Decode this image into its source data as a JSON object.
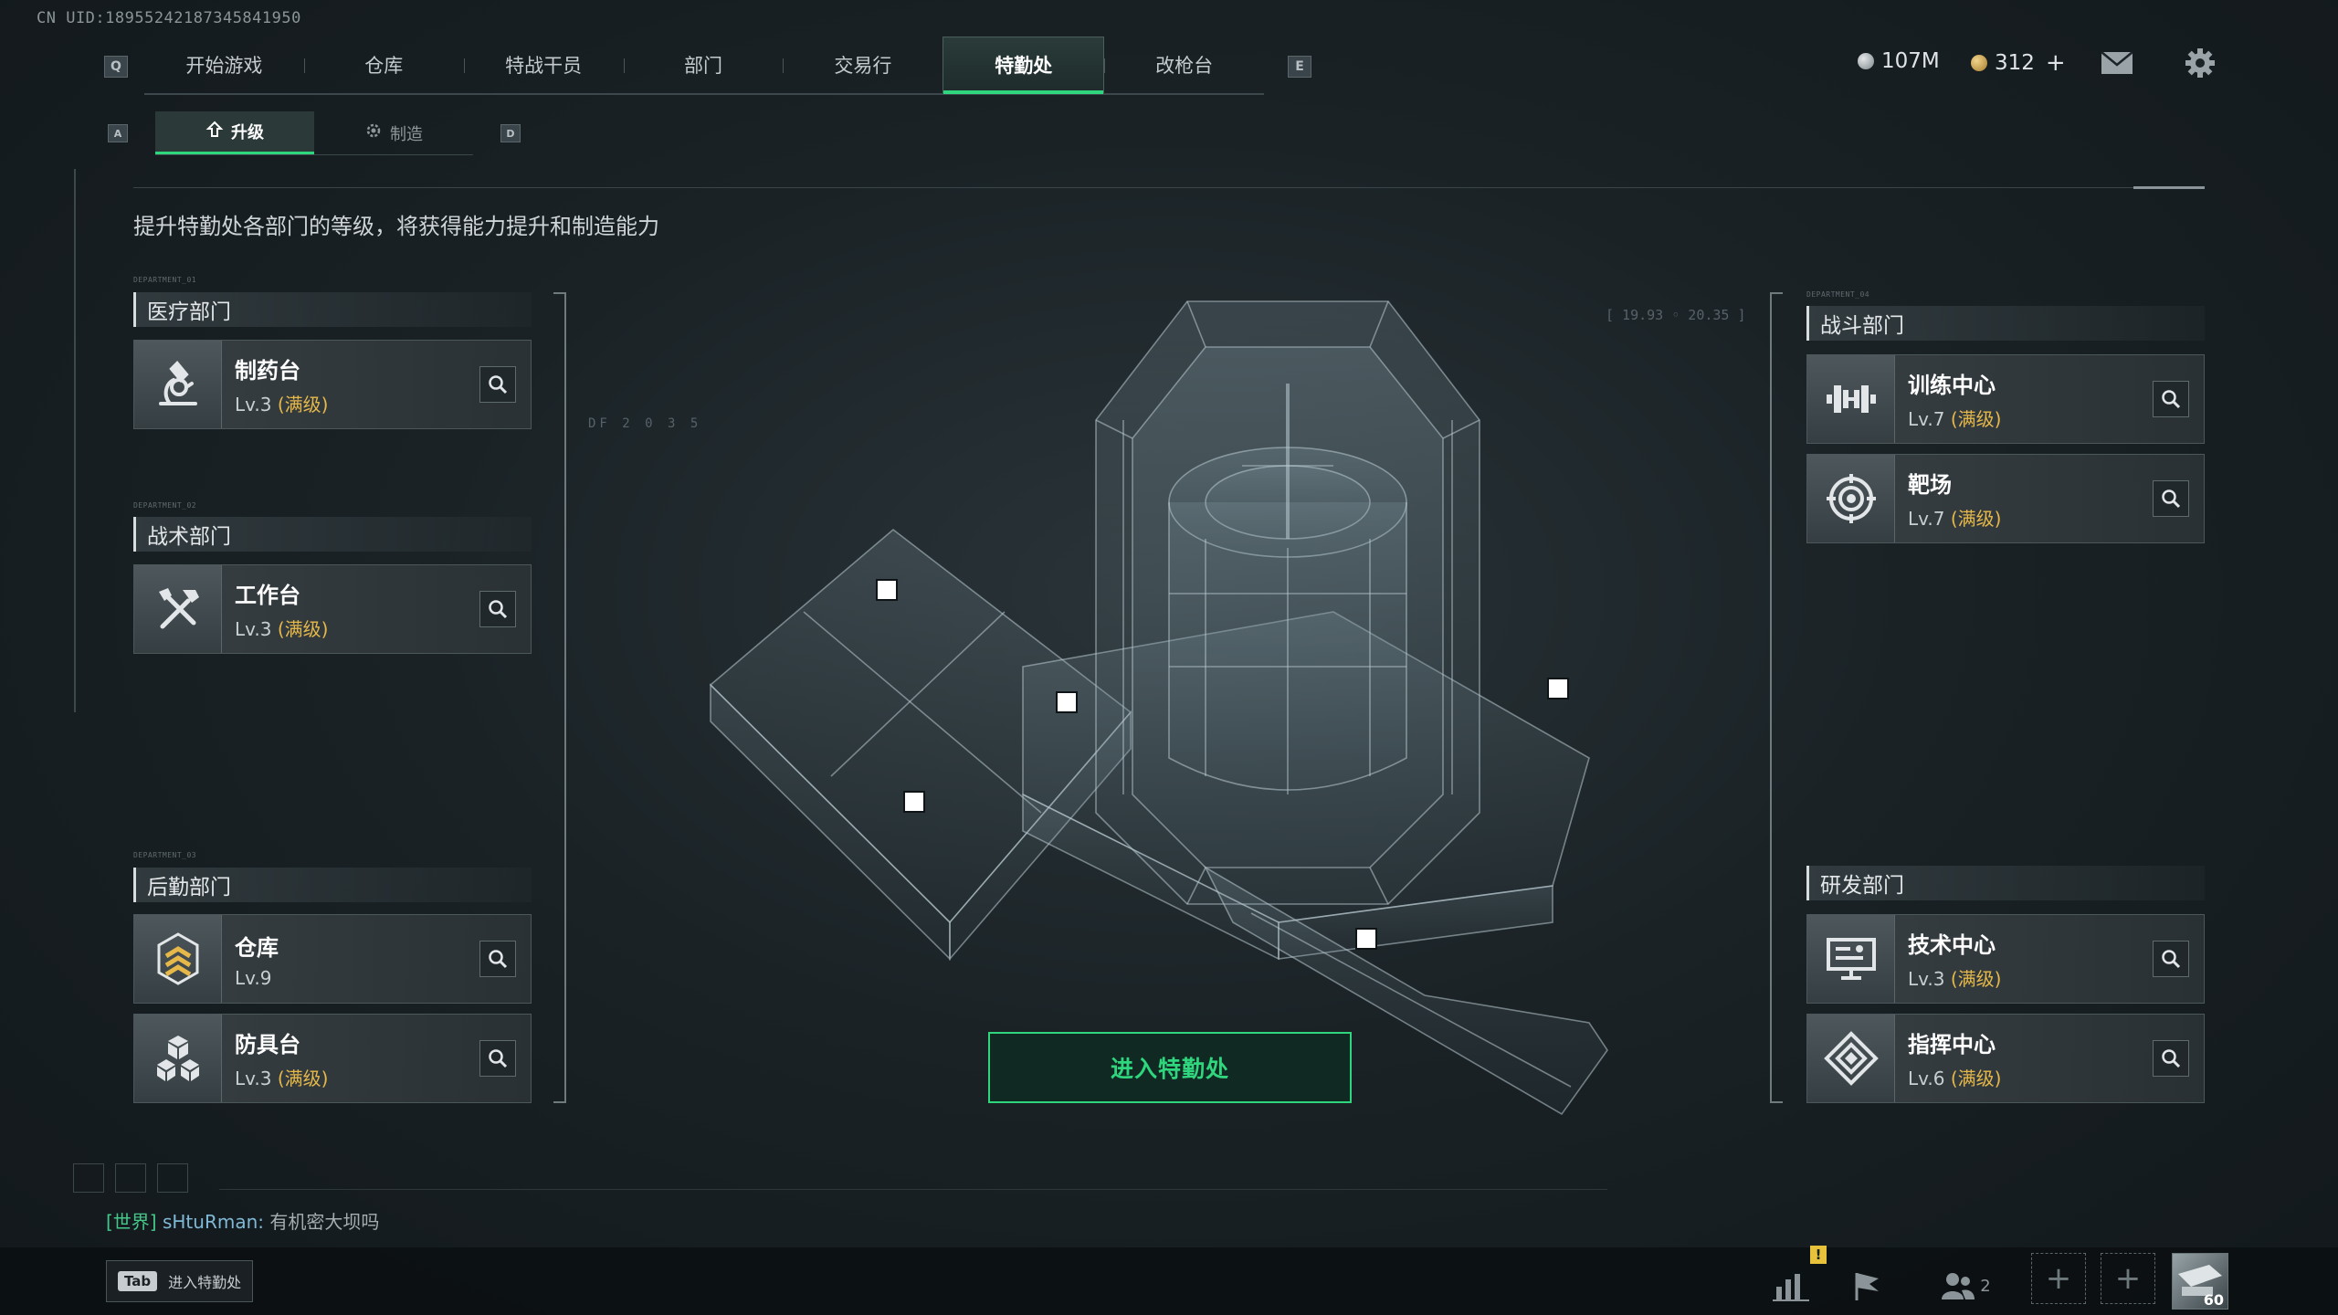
{
  "uid": "CN UID:18955242187345841950",
  "nav": {
    "left_key": "Q",
    "right_key": "E",
    "tabs": [
      {
        "label": "开始游戏",
        "active": false
      },
      {
        "label": "仓库",
        "active": false
      },
      {
        "label": "特战干员",
        "active": false
      },
      {
        "label": "部门",
        "active": false
      },
      {
        "label": "交易行",
        "active": false
      },
      {
        "label": "特勤处",
        "active": true
      },
      {
        "label": "改枪台",
        "active": false
      }
    ]
  },
  "currency": {
    "silver": "107M",
    "gold": "312",
    "gold_add": "+"
  },
  "subtabs": {
    "left_key": "A",
    "right_key": "D",
    "items": [
      {
        "label": "升级",
        "icon": "upgrade-icon",
        "active": true
      },
      {
        "label": "制造",
        "icon": "gear-icon",
        "active": false
      }
    ]
  },
  "description": "提升特勤处各部门的等级，将获得能力提升和制造能力",
  "departments": {
    "medical": {
      "tag": "DEPARTMENT_01",
      "title": "医疗部门",
      "items": [
        {
          "name": "制药台",
          "lv": "Lv.3",
          "status": "(满级)",
          "icon": "microscope-icon"
        }
      ]
    },
    "tactical": {
      "tag": "DEPARTMENT_02",
      "title": "战术部门",
      "items": [
        {
          "name": "工作台",
          "lv": "Lv.3",
          "status": "(满级)",
          "icon": "tools-icon"
        }
      ]
    },
    "logistics": {
      "tag": "DEPARTMENT_03",
      "title": "后勤部门",
      "items": [
        {
          "name": "仓库",
          "lv": "Lv.9",
          "status": "",
          "icon": "rank-chevrons-icon"
        },
        {
          "name": "防具台",
          "lv": "Lv.3",
          "status": "(满级)",
          "icon": "cubes-icon"
        }
      ]
    },
    "combat": {
      "tag": "DEPARTMENT_04",
      "title": "战斗部门",
      "items": [
        {
          "name": "训练中心",
          "lv": "Lv.7",
          "status": "(满级)",
          "icon": "dumbbell-icon"
        },
        {
          "name": "靶场",
          "lv": "Lv.7",
          "status": "(满级)",
          "icon": "target-icon"
        }
      ]
    },
    "research": {
      "title": "研发部门",
      "items": [
        {
          "name": "技术中心",
          "lv": "Lv.3",
          "status": "(满级)",
          "icon": "computer-icon"
        },
        {
          "name": "指挥中心",
          "lv": "Lv.6",
          "status": "(满级)",
          "icon": "command-diamond-icon"
        }
      ]
    }
  },
  "enter_button": "进入特勤处",
  "chat": {
    "channel": "[世界]",
    "name": "sHtuRman:",
    "message": "有机密大坝吗"
  },
  "tab_hint": {
    "key": "Tab",
    "label": "进入特勤处"
  },
  "bottom": {
    "friends_count": "2",
    "alert": "!",
    "level_badge": "60"
  },
  "deco": {
    "coords": "[ 19.93 ◦ 20.35 ]",
    "df_code": "DF 2 0 3 5"
  },
  "colors": {
    "accent": "#2fd67e",
    "max_level": "#e6b84a",
    "alert": "#e8c23a"
  }
}
